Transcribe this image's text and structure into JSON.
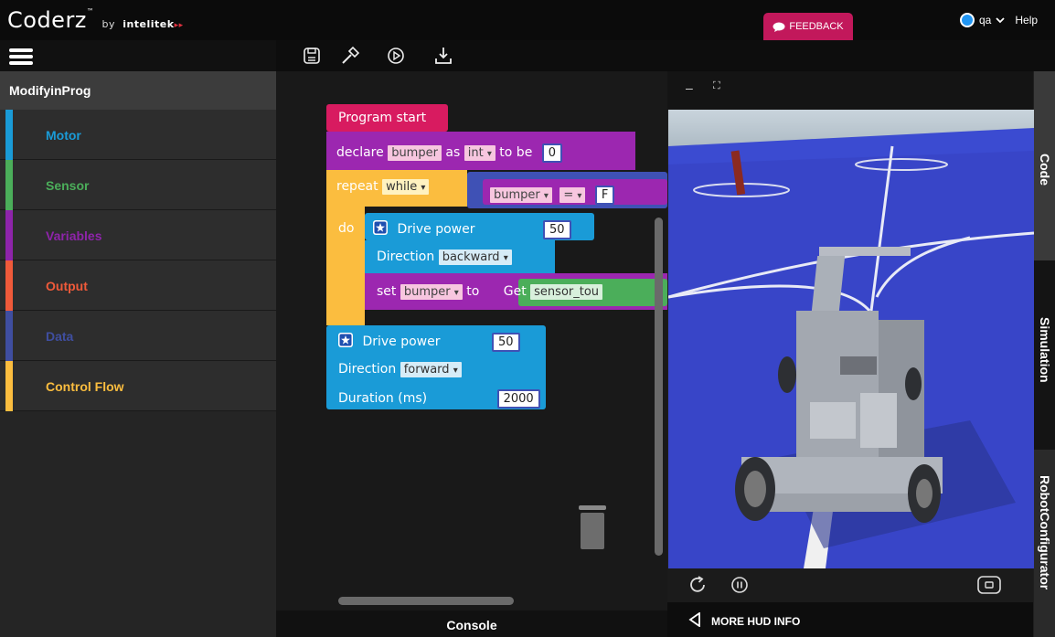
{
  "app": {
    "logo": "Coderz",
    "logo_tm": "™",
    "logo_by": "by",
    "logo_brand": "intelitek",
    "logo_arrows": "▸▸"
  },
  "header": {
    "feedback_label": "FEEDBACK",
    "user_name": "qa",
    "help_label": "Help"
  },
  "toolbar": {
    "icons": [
      "save-icon",
      "build-icon",
      "play-icon",
      "download-icon"
    ]
  },
  "sidebar": {
    "project_title": "ModifyinProg",
    "categories": [
      {
        "label": "Motor",
        "color": "#1a9bd7"
      },
      {
        "label": "Sensor",
        "color": "#4bae5a"
      },
      {
        "label": "Variables",
        "color": "#8e24aa"
      },
      {
        "label": "Output",
        "color": "#ef5a3a"
      },
      {
        "label": "Data",
        "color": "#3f4ea0"
      },
      {
        "label": "Control Flow",
        "color": "#fbbd3f"
      }
    ]
  },
  "code": {
    "program_start": "Program start",
    "declare": "declare",
    "var_name": "bumper",
    "as": "as",
    "type": "int",
    "to_be": "to be",
    "init_value": "0",
    "repeat": "repeat",
    "while": "while",
    "eq": "=",
    "cmp_value": "F",
    "do": "do",
    "drive_power": "Drive power",
    "power1": "50",
    "direction": "Direction",
    "dir1": "backward",
    "set": "set",
    "to": "to",
    "get": "Get",
    "sensor": "sensor_tou",
    "power2": "50",
    "dir2": "forward",
    "duration": "Duration (ms)",
    "duration_value": "2000",
    "dropdown_arrow": "▾"
  },
  "console_label": "Console",
  "simulation": {
    "minimize": "–",
    "fullscreen": "⛶",
    "hud_label": "MORE HUD INFO"
  },
  "right_tabs": [
    "Code",
    "Simulation",
    "RobotConfigurator"
  ],
  "colors": {
    "purple": "#9c27b0",
    "orange": "#fbbd3f",
    "blue": "#1a9bd7",
    "green": "#4bae5a",
    "red": "#d81b60",
    "feedback": "#c2185b"
  }
}
